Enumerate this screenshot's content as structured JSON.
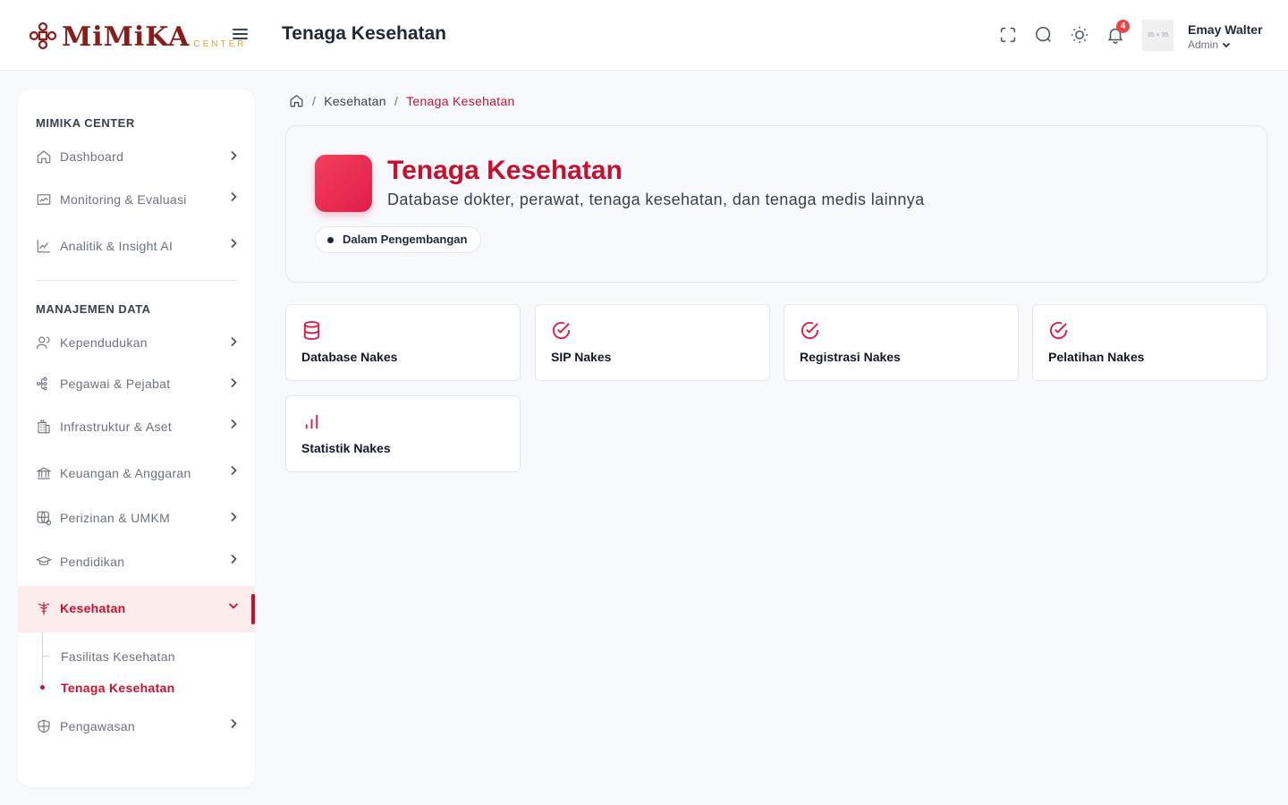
{
  "header": {
    "logo_text": "MiMiKA",
    "logo_sub": "CENTER",
    "page_title": "Tenaga Kesehatan",
    "notification_count": "4",
    "avatar_placeholder": "35 × 35",
    "user_name": "Emay Walter",
    "user_role": "Admin"
  },
  "sidebar": {
    "section1_title": "MIMIKA CENTER",
    "section2_title": "MANAJEMEN DATA",
    "items": [
      {
        "label": "Dashboard"
      },
      {
        "label": "Monitoring & Evaluasi"
      },
      {
        "label": "Analitik & Insight AI"
      },
      {
        "label": "Kependudukan"
      },
      {
        "label": "Pegawai & Pejabat"
      },
      {
        "label": "Infrastruktur & Aset"
      },
      {
        "label": "Keuangan & Anggaran"
      },
      {
        "label": "Perizinan & UMKM"
      },
      {
        "label": "Pendidikan"
      },
      {
        "label": "Kesehatan"
      },
      {
        "label": "Pengawasan"
      }
    ],
    "sub_items": [
      {
        "label": "Fasilitas Kesehatan"
      },
      {
        "label": "Tenaga Kesehatan"
      }
    ]
  },
  "breadcrumb": {
    "parent": "Kesehatan",
    "current": "Tenaga Kesehatan"
  },
  "hero": {
    "title": "Tenaga Kesehatan",
    "description": "Database dokter, perawat, tenaga kesehatan, dan tenaga medis lainnya",
    "status": "Dalam Pengembangan"
  },
  "cards": [
    {
      "label": "Database Nakes",
      "icon": "database-icon"
    },
    {
      "label": "SIP Nakes",
      "icon": "check-circle-icon"
    },
    {
      "label": "Registrasi Nakes",
      "icon": "check-circle-icon"
    },
    {
      "label": "Pelatihan Nakes",
      "icon": "check-circle-icon"
    },
    {
      "label": "Statistik Nakes",
      "icon": "bar-chart-icon"
    }
  ],
  "colors": {
    "accent": "#c8102e",
    "logo": "#8b1c1c",
    "logo_sub": "#e0a030"
  }
}
